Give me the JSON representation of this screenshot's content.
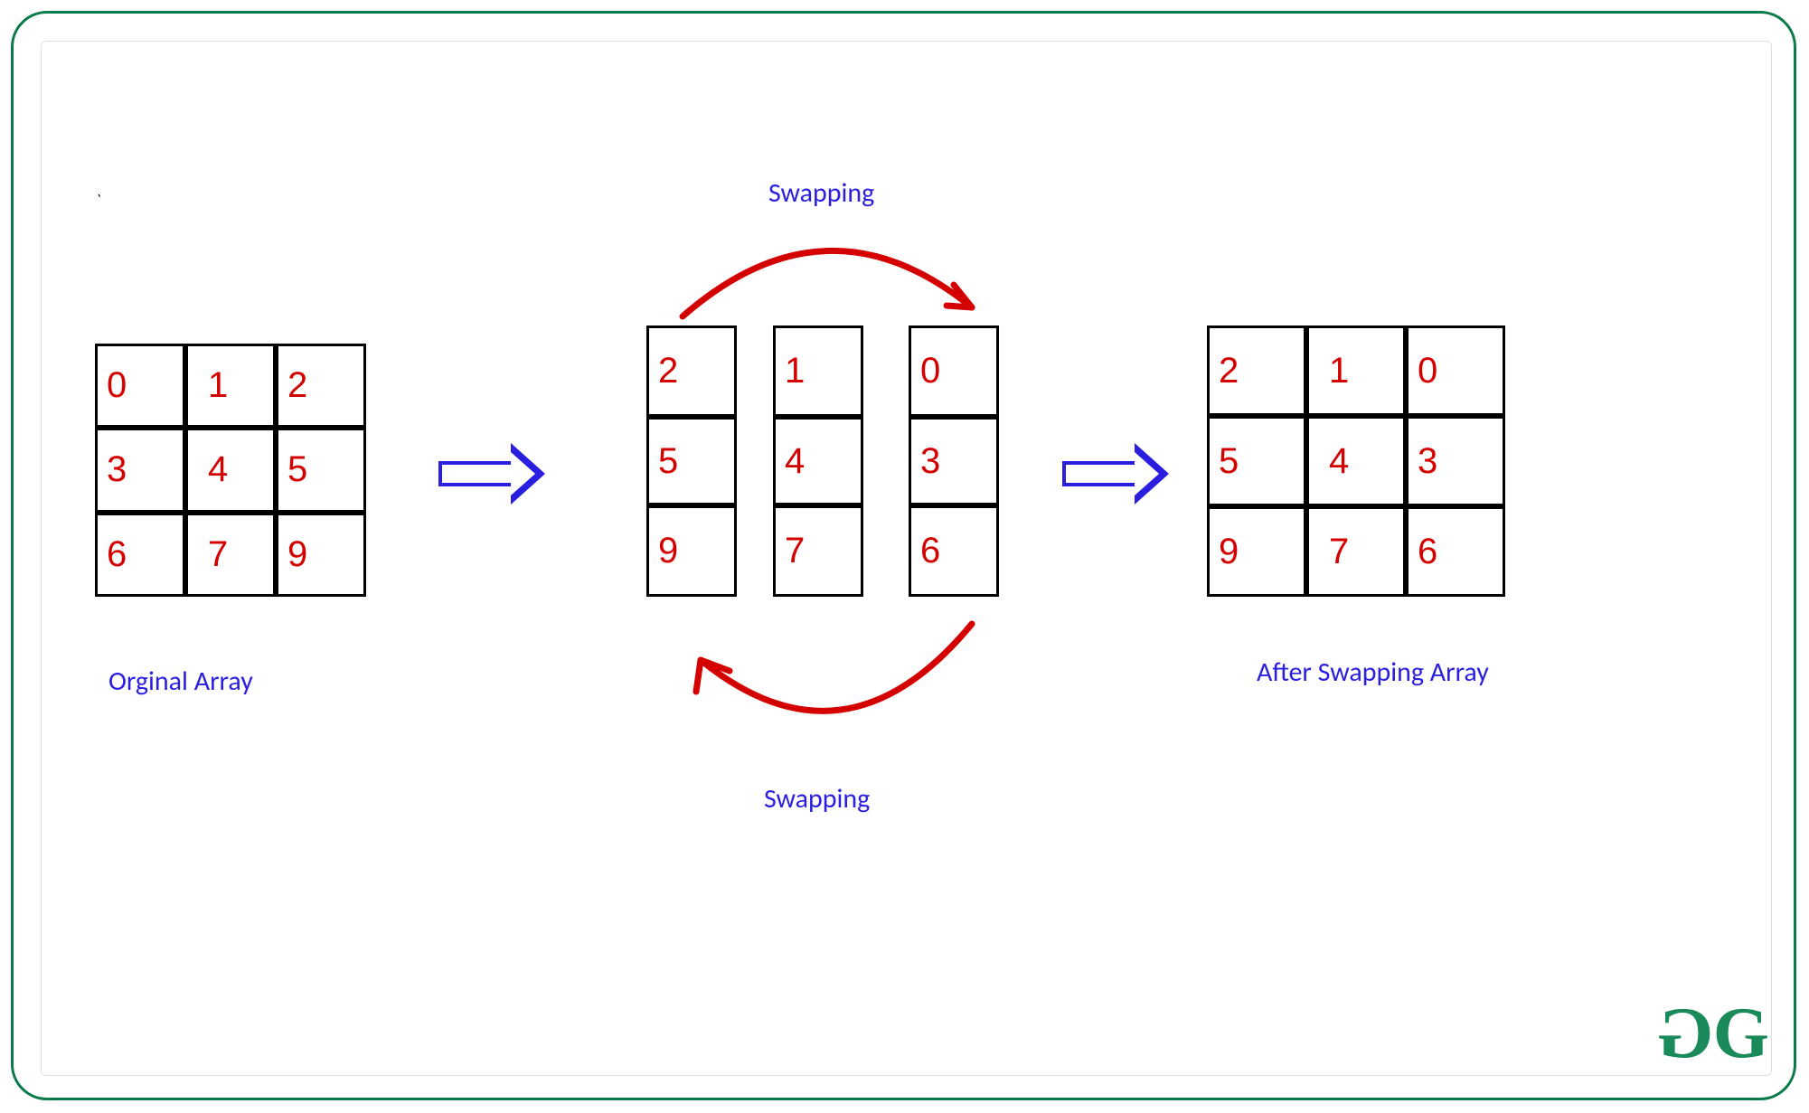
{
  "labels": {
    "original": "Orginal Array",
    "swap_top": "Swapping",
    "swap_bottom": "Swapping",
    "result": "After Swapping Array"
  },
  "original_matrix": [
    [
      "0",
      "1",
      "2"
    ],
    [
      "3",
      "4",
      "5"
    ],
    [
      "6",
      "7",
      "9"
    ]
  ],
  "middle_columns": [
    [
      "2",
      "5",
      "9"
    ],
    [
      "1",
      "4",
      "7"
    ],
    [
      "0",
      "3",
      "6"
    ]
  ],
  "result_matrix": [
    [
      "2",
      "1",
      "0"
    ],
    [
      "5",
      "4",
      "3"
    ],
    [
      "9",
      "7",
      "6"
    ]
  ],
  "logo_text": {
    "left": "G",
    "right": "G"
  }
}
